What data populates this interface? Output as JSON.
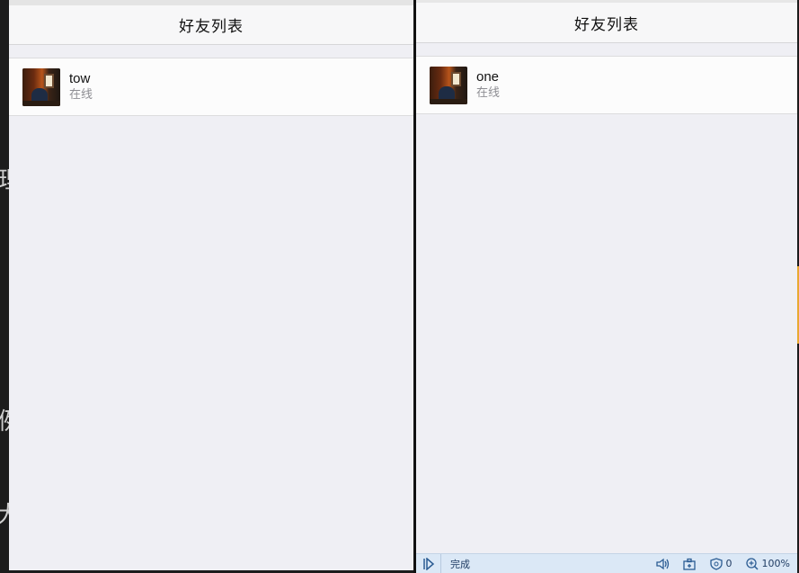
{
  "left_window": {
    "nav_title": "好友列表",
    "friends": [
      {
        "name": "tow",
        "status": "在线"
      }
    ]
  },
  "right_window": {
    "nav_title": "好友列表",
    "friends": [
      {
        "name": "one",
        "status": "在线"
      }
    ],
    "statusbar": {
      "status_text": "完成",
      "tracking_count": "0",
      "zoom": "100%"
    }
  },
  "background_glyphs": [
    "理",
    "例",
    "大"
  ],
  "colors": {
    "navbar_bg": "#f7f7f8",
    "page_bg": "#efeff4",
    "statusbar_bg": "#dbe8f6",
    "status_gray": "#8e8e93"
  }
}
